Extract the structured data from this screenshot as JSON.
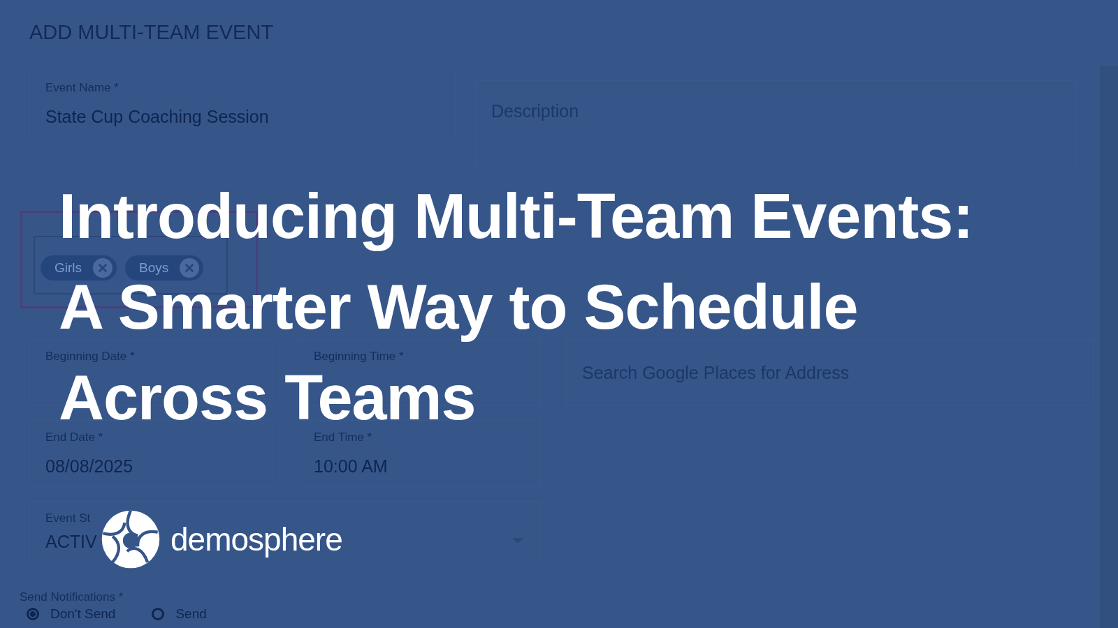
{
  "form": {
    "title": "ADD MULTI-TEAM EVENT",
    "event_name": {
      "label": "Event Name *",
      "value": "State Cup Coaching Session"
    },
    "description": {
      "placeholder": "Description"
    },
    "teams": [
      {
        "label": "Girls"
      },
      {
        "label": "Boys"
      }
    ],
    "beginning_date": {
      "label": "Beginning Date *"
    },
    "beginning_time": {
      "label": "Beginning Time *"
    },
    "location": {
      "placeholder": "Search Google Places for Address"
    },
    "end_date": {
      "label": "End Date *",
      "value": "08/08/2025"
    },
    "end_time": {
      "label": "End Time *",
      "value": "10:00 AM"
    },
    "event_status": {
      "label": "Event St",
      "value": "ACTIV"
    },
    "send_notifications": {
      "label": "Send Notifications *",
      "options": [
        {
          "label": "Don't Send",
          "selected": true
        },
        {
          "label": "Send",
          "selected": false
        }
      ]
    }
  },
  "headline": [
    "Introducing Multi-Team Events:",
    "A Smarter Way to Schedule",
    "Across Teams"
  ],
  "brand": {
    "name": "demosphere"
  }
}
